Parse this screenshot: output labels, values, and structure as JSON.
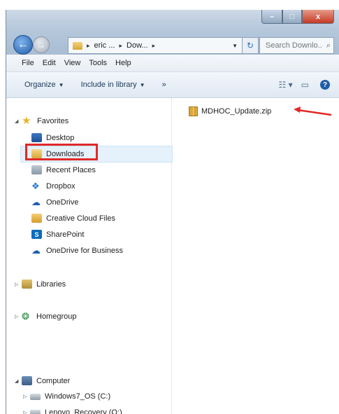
{
  "window": {
    "controls": {
      "minimize": "–",
      "maximize": "□",
      "close": "x"
    }
  },
  "address_bar": {
    "crumbs": [
      "eric ...",
      "Dow..."
    ],
    "separator": "▸",
    "search_placeholder": "Search Downlo..."
  },
  "menu": [
    "File",
    "Edit",
    "View",
    "Tools",
    "Help"
  ],
  "toolbar": {
    "organize": "Organize",
    "include_in_library": "Include in library",
    "more": "»"
  },
  "navigation": {
    "favorites": {
      "label": "Favorites",
      "items": [
        "Desktop",
        "Downloads",
        "Recent Places",
        "Dropbox",
        "OneDrive",
        "Creative Cloud Files",
        "SharePoint",
        "OneDrive for Business"
      ]
    },
    "libraries": "Libraries",
    "homegroup": "Homegroup",
    "computer": {
      "label": "Computer",
      "drives": [
        "Windows7_OS (C:)",
        "Lenovo_Recovery (Q:)"
      ]
    },
    "selected": "Downloads"
  },
  "content": {
    "files": [
      {
        "name": "MDHOC_Update.zip",
        "icon": "zip-folder-icon"
      }
    ]
  },
  "colors": {
    "annotation_red": "#e02929",
    "selection": "#e5f1fb"
  }
}
